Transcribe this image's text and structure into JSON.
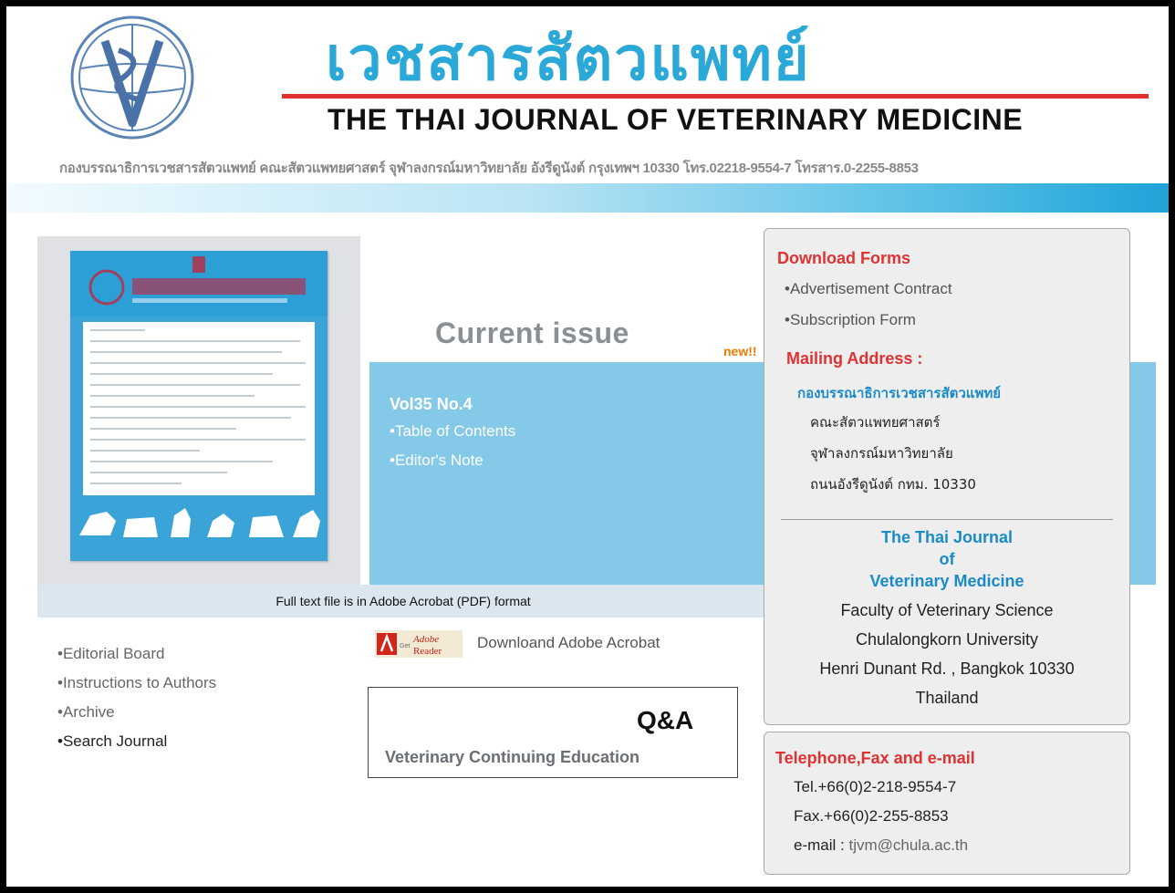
{
  "header": {
    "title_thai": "เวชสารสัตวแพทย์",
    "title_en": "THE THAI JOURNAL OF VETERINARY MEDICINE",
    "address_line": "กองบรรณาธิการเวชสารสัตวแพทย์ คณะสัตวแพทยศาสตร์ จุฬาลงกรณ์มหาวิทยาลัย อังรีดูนังต์ กรุงเทพฯ 10330 โทร.02218-9554-7 โทรสาร.0-2255-8853",
    "logo_icon": "veterinary-caduceus-logo"
  },
  "current_issue": {
    "heading": "Current issue",
    "new_badge": "new!!",
    "volume": "Vol35 No.4",
    "links": [
      "Table of Contents",
      "Editor's Note"
    ],
    "pdf_note": "Full text file is in Adobe Acrobat (PDF) format",
    "adobe_link": "Downloand Adobe Acrobat",
    "adobe_icon": "get-adobe-reader-icon"
  },
  "nav": {
    "items": [
      "Editorial Board",
      "Instructions to Authors",
      "Archive",
      "Search Journal"
    ]
  },
  "qa_box": {
    "title": "Q&A",
    "subtitle": "Veterinary Continuing Education"
  },
  "download_forms": {
    "heading": "Download Forms",
    "items": [
      "Advertisement Contract",
      "Subscription Form"
    ]
  },
  "mailing": {
    "heading": "Mailing Address :",
    "thai_org": "กองบรรณาธิการเวชสารสัตวแพทย์",
    "thai_lines": [
      "คณะสัตวแพทยศาสตร์",
      "จุฬาลงกรณ์มหาวิทยาลัย",
      "ถนนอังรีดูนังต์ กทม. 10330"
    ],
    "en_title_lines": [
      "The Thai Journal",
      "of",
      "Veterinary Medicine"
    ],
    "en_lines": [
      "Faculty of Veterinary Science",
      "Chulalongkorn University",
      "Henri Dunant Rd. , Bangkok 10330",
      "Thailand"
    ]
  },
  "contact": {
    "heading": "Telephone,Fax and e-mail",
    "tel": "Tel.+66(0)2-218-9554-7",
    "fax": "Fax.+66(0)2-255-8853",
    "email_label": "e-mail :",
    "email": "tjvm@chula.ac.th"
  },
  "colors": {
    "accent_red": "#e03232",
    "accent_blue": "#1b8bc8",
    "issue_box": "#85c9e8",
    "new_orange": "#ee7a00"
  }
}
